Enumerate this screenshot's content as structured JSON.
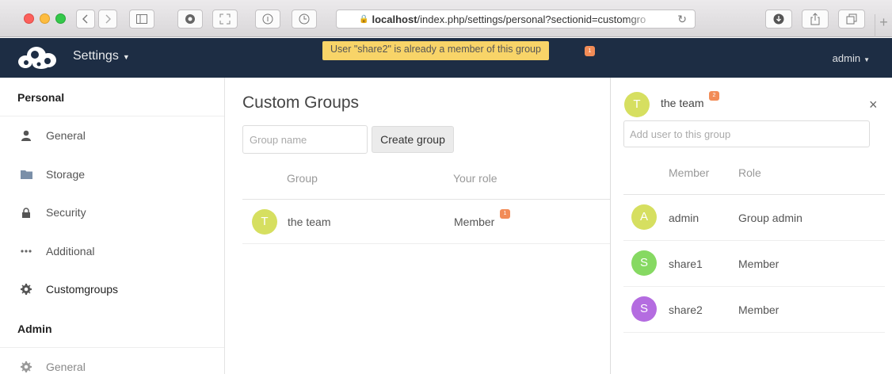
{
  "browser": {
    "url_host": "localhost",
    "url_path": "/index.php/settings/personal?sectionid=customgro",
    "new_tab": "+"
  },
  "header": {
    "app_menu_label": "Settings",
    "user_menu_label": "admin",
    "notification": "User \"share2\" is already a member of this group",
    "notification_badge": "1"
  },
  "sidebar": {
    "personal_heading": "Personal",
    "personal_items": [
      {
        "label": "General",
        "icon": "user-icon"
      },
      {
        "label": "Storage",
        "icon": "folder-icon"
      },
      {
        "label": "Security",
        "icon": "lock-icon"
      },
      {
        "label": "Additional",
        "icon": "more-icon"
      },
      {
        "label": "Customgroups",
        "icon": "gear-icon"
      }
    ],
    "admin_heading": "Admin",
    "admin_items": [
      {
        "label": "General",
        "icon": "gear-icon"
      }
    ]
  },
  "main": {
    "title": "Custom Groups",
    "group_name_placeholder": "Group name",
    "create_button": "Create group",
    "columns": {
      "group": "Group",
      "role": "Your role"
    },
    "groups": [
      {
        "initial": "T",
        "name": "the team",
        "role": "Member",
        "avatar_color": "#d6df60",
        "badge": "1"
      }
    ]
  },
  "panel": {
    "avatar_initial": "T",
    "avatar_color": "#d6df60",
    "title": "the team",
    "title_badge": "2",
    "close": "×",
    "add_user_placeholder": "Add user to this group",
    "columns": {
      "member": "Member",
      "role": "Role"
    },
    "members": [
      {
        "initial": "A",
        "name": "admin",
        "role": "Group admin",
        "avatar_color": "#d6df60"
      },
      {
        "initial": "S",
        "name": "share1",
        "role": "Member",
        "avatar_color": "#86d962"
      },
      {
        "initial": "S",
        "name": "share2",
        "role": "Member",
        "avatar_color": "#b46ce0"
      }
    ]
  },
  "colors": {
    "header_bg": "#1d2d44",
    "notification_bg": "#f8d468",
    "badge": "#f28c57"
  }
}
